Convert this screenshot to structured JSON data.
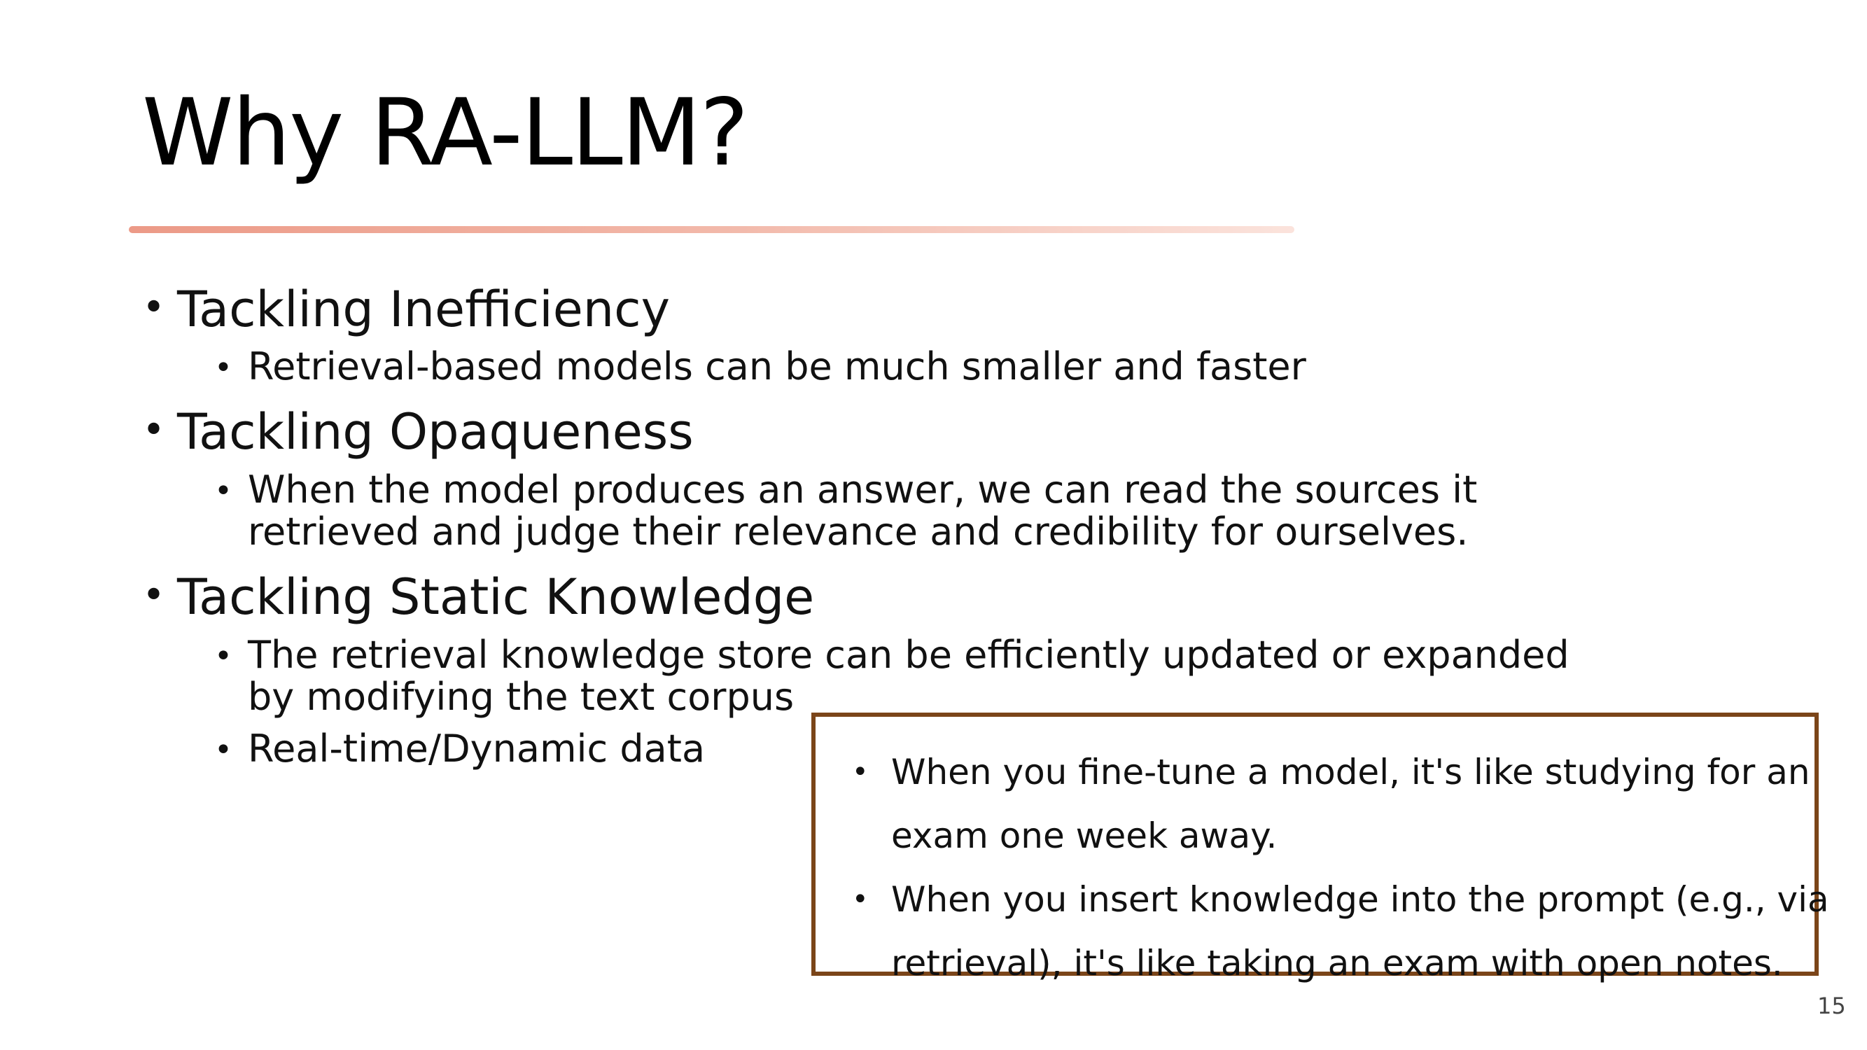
{
  "slide": {
    "title": "Why RA-LLM?",
    "bullets": [
      {
        "heading": "Tackling Inefficiency",
        "subs": [
          "Retrieval-based models can be much smaller and faster"
        ]
      },
      {
        "heading": "Tackling Opaqueness",
        "subs": [
          "When the model produces an answer, we can read the sources it",
          "retrieved and judge their relevance and credibility for ourselves."
        ]
      },
      {
        "heading": "Tackling Static Knowledge",
        "subs": [
          "The retrieval knowledge store can be efficiently updated or expanded",
          "by modifying the  text corpus",
          "Real-time/Dynamic data"
        ]
      }
    ],
    "bullet_glyph": "•",
    "callout": {
      "items": [
        [
          "When you fine-tune a model, it's like studying for an",
          "exam one week away."
        ],
        [
          "When you insert knowledge into the prompt (e.g., via",
          "retrieval), it's like taking an exam with open notes."
        ]
      ]
    },
    "page_number": "15",
    "colors": {
      "title_rule_start": "#ec9a87",
      "title_rule_end": "#fbe3dc",
      "callout_border": "#7b4519"
    }
  }
}
